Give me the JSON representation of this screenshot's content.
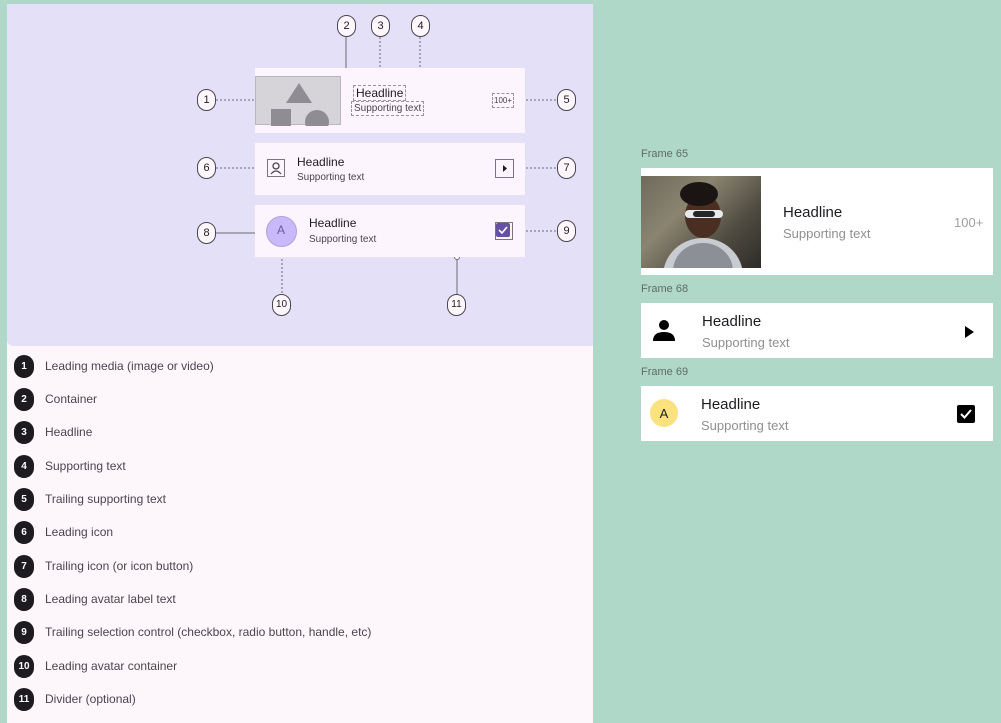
{
  "spec": {
    "rows": [
      {
        "headline": "Headline",
        "supporting": "Supporting text",
        "trailing": "100+"
      },
      {
        "headline": "Headline",
        "supporting": "Supporting text"
      },
      {
        "headline": "Headline",
        "supporting": "Supporting text",
        "avatar_letter": "A"
      }
    ],
    "callouts": [
      "1",
      "2",
      "3",
      "4",
      "5",
      "6",
      "7",
      "8",
      "9",
      "10",
      "11"
    ]
  },
  "legend": [
    {
      "num": "1",
      "label": "Leading media (image or video)"
    },
    {
      "num": "2",
      "label": "Container"
    },
    {
      "num": "3",
      "label": "Headline"
    },
    {
      "num": "4",
      "label": "Supporting text"
    },
    {
      "num": "5",
      "label": "Trailing supporting text"
    },
    {
      "num": "6",
      "label": "Leading icon"
    },
    {
      "num": "7",
      "label": "Trailing icon (or icon button)"
    },
    {
      "num": "8",
      "label": "Leading avatar label text"
    },
    {
      "num": "9",
      "label": "Trailing selection control (checkbox, radio button, handle, etc)"
    },
    {
      "num": "10",
      "label": "Leading avatar container"
    },
    {
      "num": "11",
      "label": "Divider (optional)"
    }
  ],
  "frames": [
    {
      "name": "Frame 65",
      "headline": "Headline",
      "supporting": "Supporting text",
      "trailing": "100+"
    },
    {
      "name": "Frame 68",
      "headline": "Headline",
      "supporting": "Supporting text"
    },
    {
      "name": "Frame 69",
      "headline": "Headline",
      "supporting": "Supporting text",
      "avatar_letter": "A"
    }
  ],
  "colors": {
    "canvas": "#b0d8c9",
    "diagram_bg": "#e3e0f7",
    "list_bg": "#fdf5fd",
    "avatar_spec": "#c9b8fa",
    "checkbox_spec": "#6750a4",
    "avatar_frame": "#fbe27f"
  },
  "icons": {
    "leading_icon": "person-icon",
    "trailing_icon": "play-arrow-icon",
    "trailing_control": "checkbox-checked-icon"
  }
}
